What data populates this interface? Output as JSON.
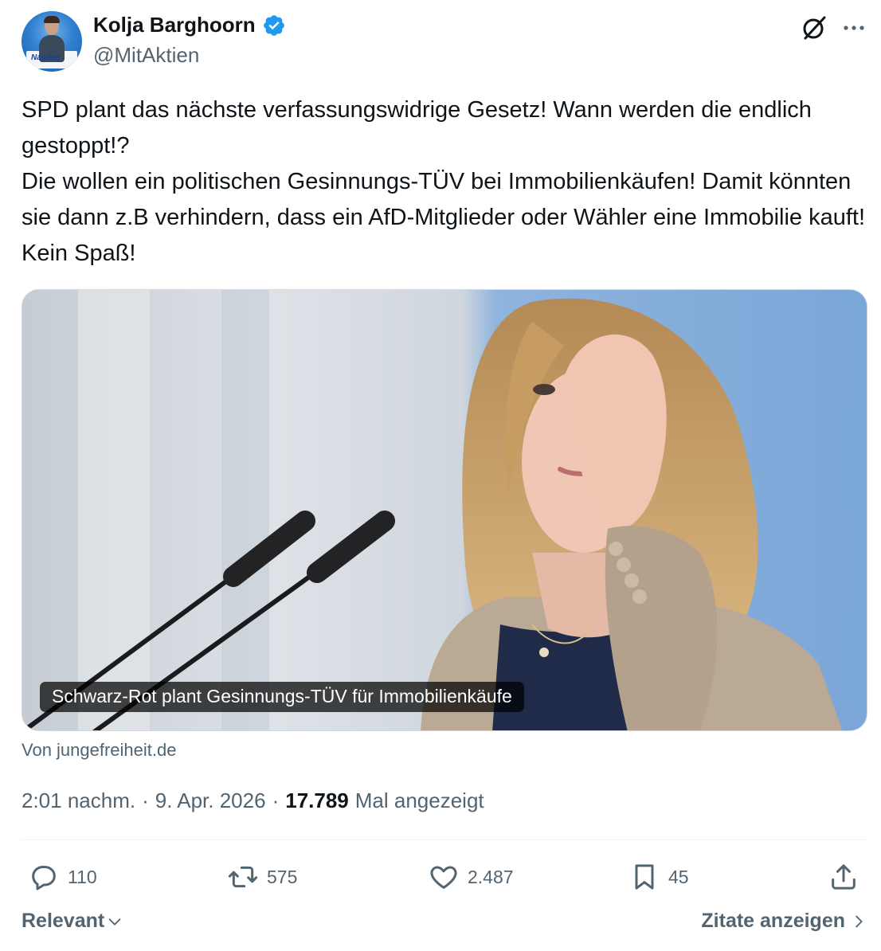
{
  "author": {
    "name": "Kolja Barghoorn",
    "handle": "@MitAktien",
    "avatar_label": "Nasdaq"
  },
  "tweet": {
    "text": "SPD plant das nächste verfassungswidrige Gesetz! Wann werden die endlich gestoppt!?\nDie wollen ein politischen Gesinnungs-TÜV bei Immobilienkäufen! Damit könnten sie dann z.B verhindern, dass ein AfD-Mitglieder oder Wähler eine Immobilie kauft! Kein Spaß!"
  },
  "card": {
    "title": "Schwarz-Rot plant Gesinnungs-TÜV für Immobilienkäufe",
    "source": "Von jungefreiheit.de"
  },
  "meta": {
    "time": "2:01 nachm.",
    "separator1": "·",
    "date": "9. Apr. 2026",
    "separator2": "·",
    "views": "17.789",
    "views_label": "Mal angezeigt"
  },
  "actions": {
    "replies": "110",
    "reposts": "575",
    "likes": "2.487",
    "bookmarks": "45"
  },
  "footer": {
    "sort_label": "Relevant",
    "quotes_label": "Zitate anzeigen"
  },
  "colors": {
    "text_primary": "#0f1419",
    "text_secondary": "#536471",
    "verified_blue": "#1d9bf0",
    "divider": "#eff3f4"
  },
  "icons": {
    "verified": "verified-badge-icon",
    "grok": "grok-icon",
    "more": "more-icon",
    "reply": "reply-icon",
    "repost": "repost-icon",
    "like": "heart-icon",
    "bookmark": "bookmark-icon",
    "share": "share-icon"
  }
}
